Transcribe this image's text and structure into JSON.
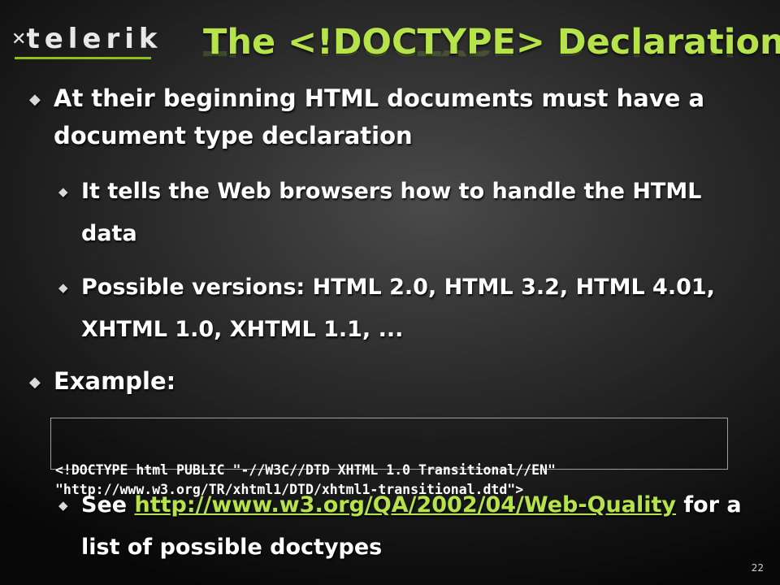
{
  "logo": {
    "text": "telerik",
    "icon": "telerik-logo-icon"
  },
  "title": "The <!DOCTYPE> Declaration",
  "bullets": {
    "b1": "At their beginning HTML documents must have a document type declaration",
    "b1_sub1": "It tells the Web browsers how to handle the HTML data",
    "b1_sub2": "Possible versions: HTML 2.0, HTML 3.2, HTML 4.01, XHTML 1.0, XHTML 1.1, ...",
    "b2": "Example:",
    "b2_sub1_prefix": "See ",
    "b2_sub1_link": "http://www.w3.org/QA/2002/04/Web-Quality",
    "b2_sub1_suffix": " for a list of possible doctypes"
  },
  "code": {
    "line1": "<!DOCTYPE html PUBLIC \"-//W3C//DTD XHTML 1.0 Transitional//EN\"",
    "line2": "\"http://www.w3.org/TR/xhtml1/DTD/xhtml1-transitional.dtd\">"
  },
  "page_number": "22",
  "colors": {
    "accent": "#b6e34a",
    "logo_underline": "#8fbf1f",
    "text": "#ffffff"
  },
  "bullet_icon_level1": "diamond-bullet-icon",
  "bullet_icon_level2": "small-diamond-bullet-icon"
}
